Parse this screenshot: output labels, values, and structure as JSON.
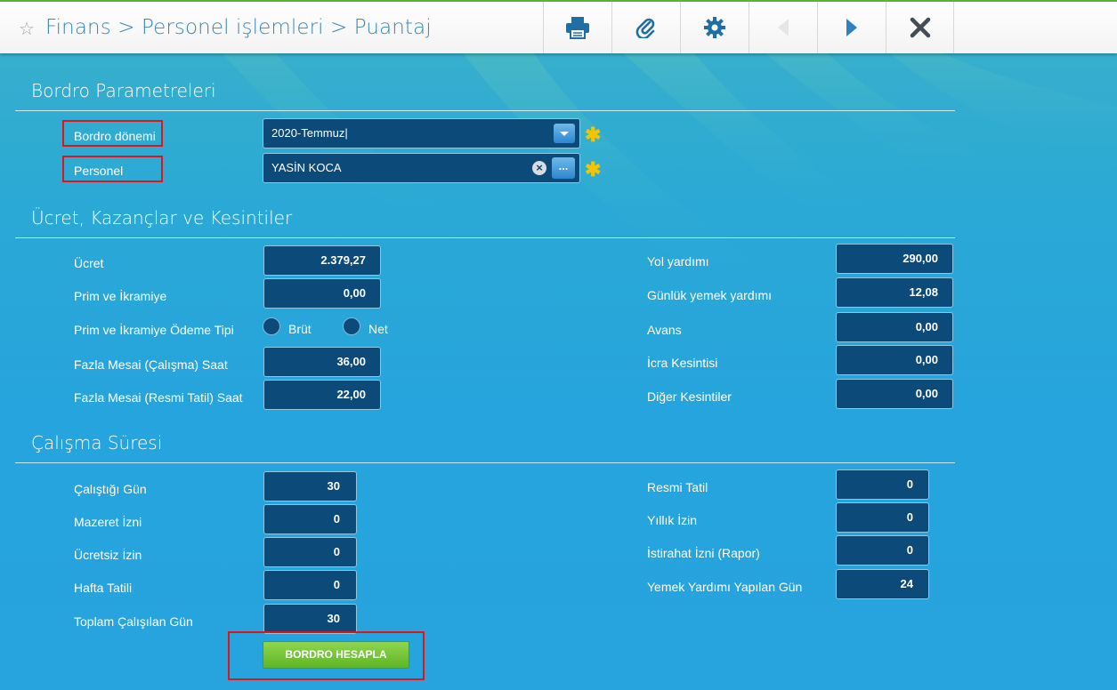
{
  "header": {
    "breadcrumb": "Finans > Personel işlemleri > Puantaj",
    "toolbar": [
      "printer-icon",
      "paperclip-icon",
      "gear-icon",
      "prev-icon",
      "next-icon",
      "close-icon"
    ]
  },
  "bordro": {
    "title": "Bordro Parametreleri",
    "period_label": "Bordro dönemi",
    "period_value": "2020-Temmuz",
    "personel_label": "Personel",
    "personel_value": "YASİN KOCA",
    "browse_label": "..."
  },
  "ucret": {
    "title": "Ücret, Kazançlar ve Kesintiler",
    "left": [
      {
        "label": "Ücret",
        "value": "2.379,27"
      },
      {
        "label": "Prim ve İkramiye",
        "value": "0,00"
      },
      {
        "label": "Prim ve İkramiye Ödeme Tipi",
        "value": null
      },
      {
        "label": "Fazla Mesai (Çalışma) Saat",
        "value": "36,00"
      },
      {
        "label": "Fazla Mesai (Resmi Tatil) Saat",
        "value": "22,00"
      }
    ],
    "radio_brut": "Brüt",
    "radio_net": "Net",
    "right": [
      {
        "label": "Yol yardımı",
        "value": "290,00"
      },
      {
        "label": "Günlük yemek yardımı",
        "value": "12,08"
      },
      {
        "label": "Avans",
        "value": "0,00"
      },
      {
        "label": "İcra Kesintisi",
        "value": "0,00"
      },
      {
        "label": "Diğer Kesintiler",
        "value": "0,00"
      }
    ]
  },
  "calisma": {
    "title": "Çalışma Süresi",
    "left": [
      {
        "label": "Çalıştığı Gün",
        "value": "30"
      },
      {
        "label": "Mazeret İzni",
        "value": "0"
      },
      {
        "label": "Ücretsiz İzin",
        "value": "0"
      },
      {
        "label": "Hafta Tatili",
        "value": "0"
      },
      {
        "label": "Toplam Çalışılan Gün",
        "value": "30"
      }
    ],
    "right": [
      {
        "label": "Resmi Tatil",
        "value": "0"
      },
      {
        "label": "Yıllık İzin",
        "value": "0"
      },
      {
        "label": "İstirahat İzni (Rapor)",
        "value": "0"
      },
      {
        "label": "Yemek Yardımı Yapılan Gün",
        "value": "24"
      }
    ]
  },
  "action": {
    "calculate_label": "BORDRO HESAPLA"
  },
  "colors": {
    "accent": "#3a87b3",
    "field_bg": "#0b4a79",
    "required": "#f5c400",
    "button": "#6cc12f",
    "highlight": "#e0141c"
  }
}
